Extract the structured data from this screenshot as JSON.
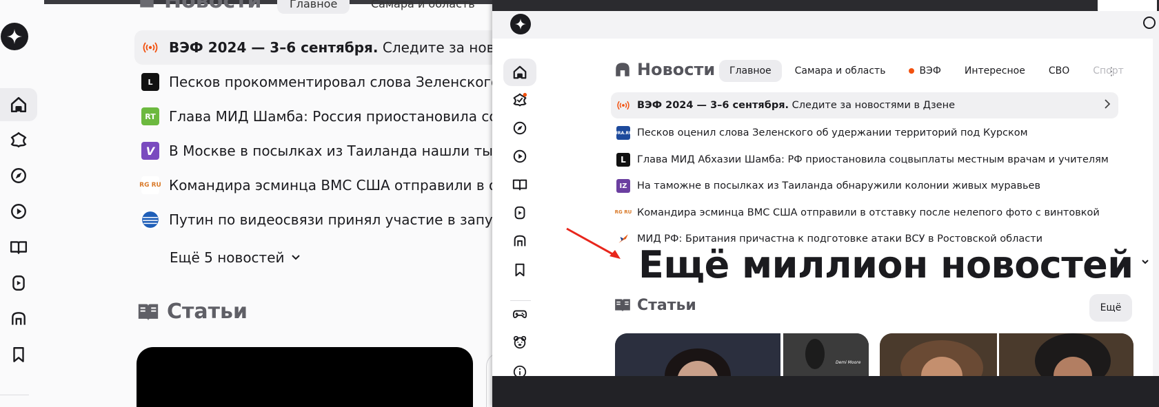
{
  "background_window": {
    "heading_top": "Новости",
    "tab_main": "Главное",
    "tab_region": "Самара и область",
    "news": [
      {
        "source_icon": "broadcast-icon",
        "bold": "ВЭФ 2024 — 3–6 сентября.",
        "text": "Следите за новостям"
      },
      {
        "source_icon": "L",
        "bold": "",
        "text": "Песков прокомментировал слова Зеленского об"
      },
      {
        "source_icon": "RT",
        "bold": "",
        "text": "Глава МИД Шамба: Россия приостановила соцв"
      },
      {
        "source_icon": "V",
        "bold": "",
        "text": "В Москве в посылках из Таиланда нашли тысячи"
      },
      {
        "source_icon": "RG RU",
        "bold": "",
        "text": "Командира эсминца ВМС США отправили в отст"
      },
      {
        "source_icon": "globe-icon",
        "bold": "",
        "text": "Путин по видеосвязи принял участие в запуске"
      }
    ],
    "more_label": "Ещё 5 новостей",
    "articles_title": "Статьи"
  },
  "foreground_window": {
    "news_title": "Новости",
    "tabs": [
      "Главное",
      "Самара и область",
      "ВЭФ",
      "Интересное",
      "СВО",
      "Спорт"
    ],
    "news": [
      {
        "source_icon": "broadcast-icon",
        "bold": "ВЭФ 2024 — 3–6 сентября.",
        "text": "Следите за новостями в Дзене"
      },
      {
        "source_icon": "URA.RU",
        "bold": "",
        "text": "Песков оценил слова Зеленского об удержании территорий под Курском"
      },
      {
        "source_icon": "L",
        "bold": "",
        "text": "Глава МИД Абхазии Шамба: РФ приостановила соцвыплаты местным врачам и учителям"
      },
      {
        "source_icon": "IZ",
        "bold": "",
        "text": "На таможне в посылках из Таиланда обнаружили колонии живых муравьев"
      },
      {
        "source_icon": "RG RU",
        "bold": "",
        "text": "Командира эсминца ВМС США отправили в отставку после нелепого фото с винтовкой"
      },
      {
        "source_icon": "eagle-icon",
        "bold": "",
        "text": "МИД РФ: Британия причастна к подготовке атаки ВСУ в Ростовской области"
      }
    ],
    "more_label": "Ещё миллион новостей",
    "articles_title": "Статьи",
    "articles_more": "Ещё",
    "card_caption": "Demi Moore"
  },
  "colors": {
    "accent_orange": "#f2510f",
    "annotation_arrow": "#e8261c",
    "rt_green": "#6cb93f",
    "viber_purple": "#7a4bbf",
    "ura_blue": "#1d4a9c",
    "iz_purple": "#6b3fa0"
  }
}
